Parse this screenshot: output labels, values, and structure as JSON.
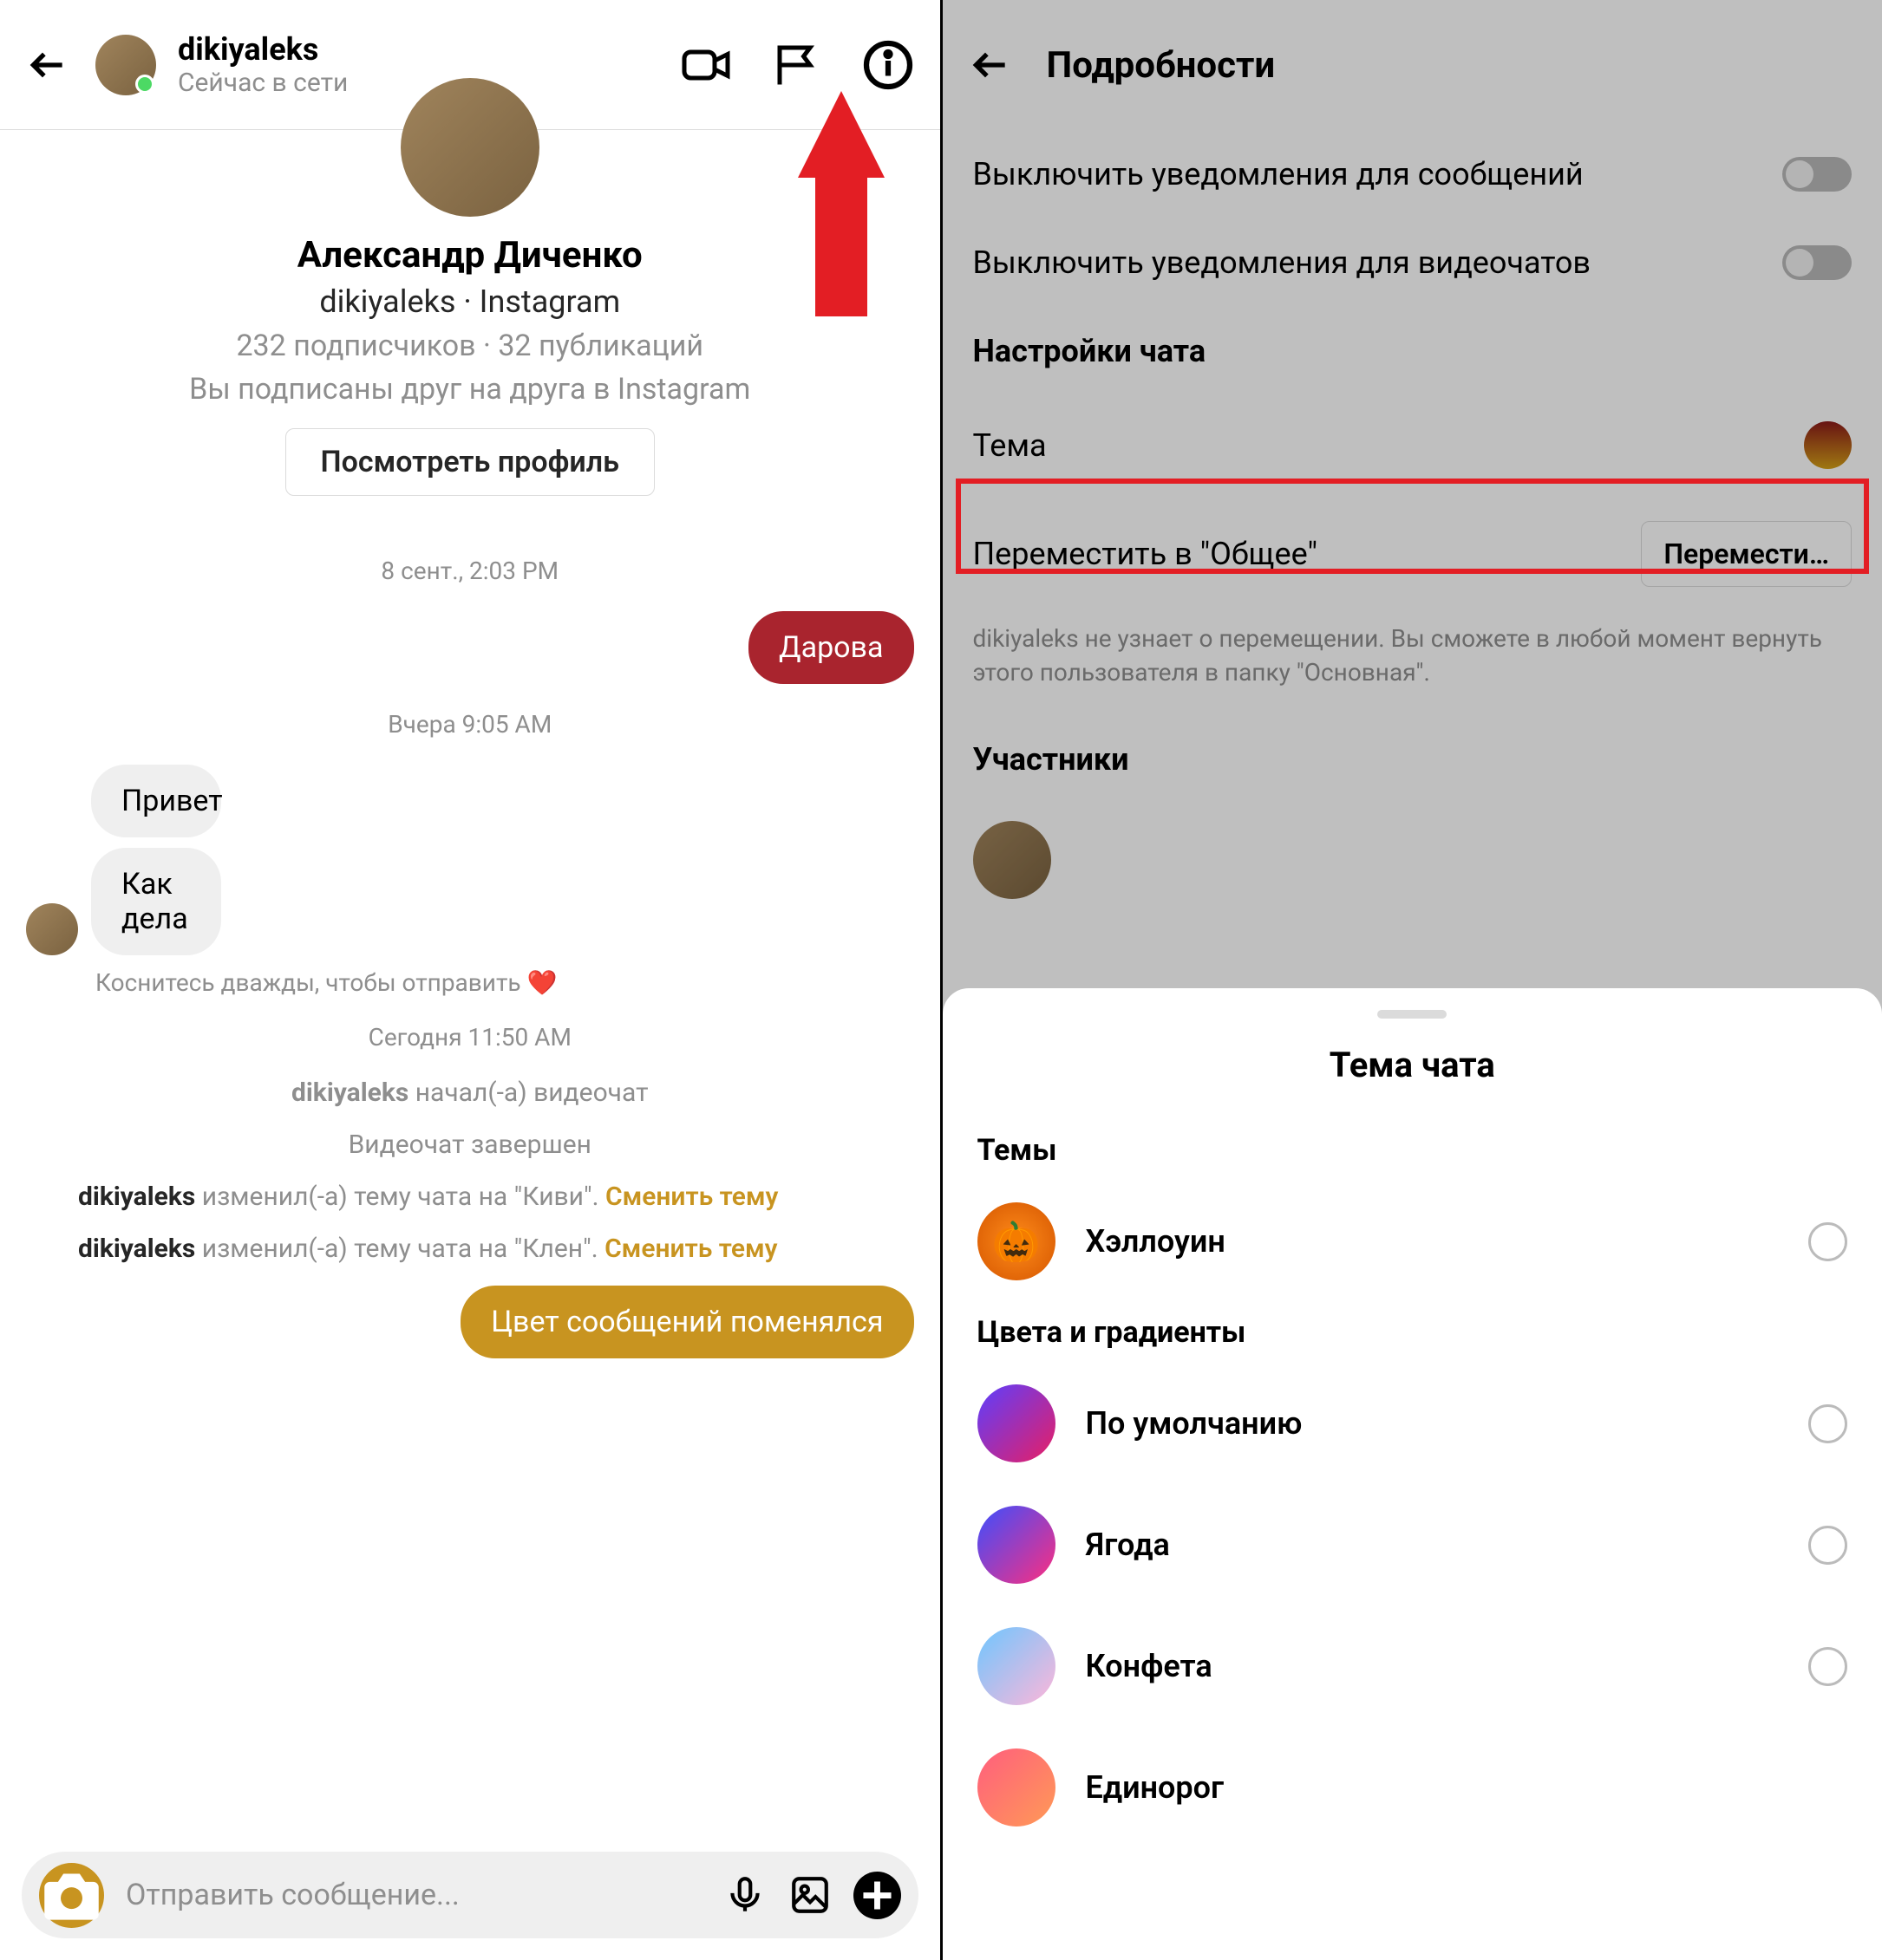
{
  "left": {
    "header": {
      "username": "dikiyaleks",
      "status": "Сейчас в сети"
    },
    "profile": {
      "name": "Александр Диченко",
      "meta": "dikiyaleks · Instagram",
      "stats": "232 подписчиков · 32 публикаций",
      "note": "Вы подписаны друг на друга в Instagram",
      "view_button": "Посмотреть профиль"
    },
    "chat": {
      "ts1": "8 сент., 2:03 PM",
      "msg1": "Дарова",
      "ts2": "Вчера 9:05 AM",
      "msg2": "Привет",
      "msg3": "Как дела",
      "like_hint": "Коснитесь дважды, чтобы отправить ❤️",
      "ts3": "Сегодня 11:50 AM",
      "sys1_user": "dikiyaleks",
      "sys1_text": " начал(-а) видеочат",
      "sys2": "Видеочат завершен",
      "theme1_user": "dikiyaleks",
      "theme1_text": " изменил(-а) тему чата на \"Киви\". ",
      "theme1_link": "Сменить тему",
      "theme2_user": "dikiyaleks",
      "theme2_text": " изменил(-а) тему чата на \"Клен\". ",
      "theme2_link": "Сменить тему",
      "msg4": "Цвет сообщений поменялся"
    },
    "composer": {
      "placeholder": "Отправить сообщение..."
    }
  },
  "right": {
    "header_title": "Подробности",
    "mute_messages": "Выключить уведомления для сообщений",
    "mute_video": "Выключить уведомления для видеочатов",
    "chat_settings": "Настройки чата",
    "theme_label": "Тема",
    "move_label": "Переместить в \"Общее\"",
    "move_button": "Перемести…",
    "move_note": "dikiyaleks не узнает о перемещении. Вы сможете в любой момент вернуть этого пользователя в папку \"Основная\".",
    "members_title": "Участники",
    "sheet": {
      "title": "Тема чата",
      "themes_section": "Темы",
      "colors_section": "Цвета и градиенты",
      "options": {
        "halloween": "Хэллоуин",
        "default": "По умолчанию",
        "berry": "Ягода",
        "candy": "Конфета",
        "unicorn": "Единорог"
      }
    }
  }
}
